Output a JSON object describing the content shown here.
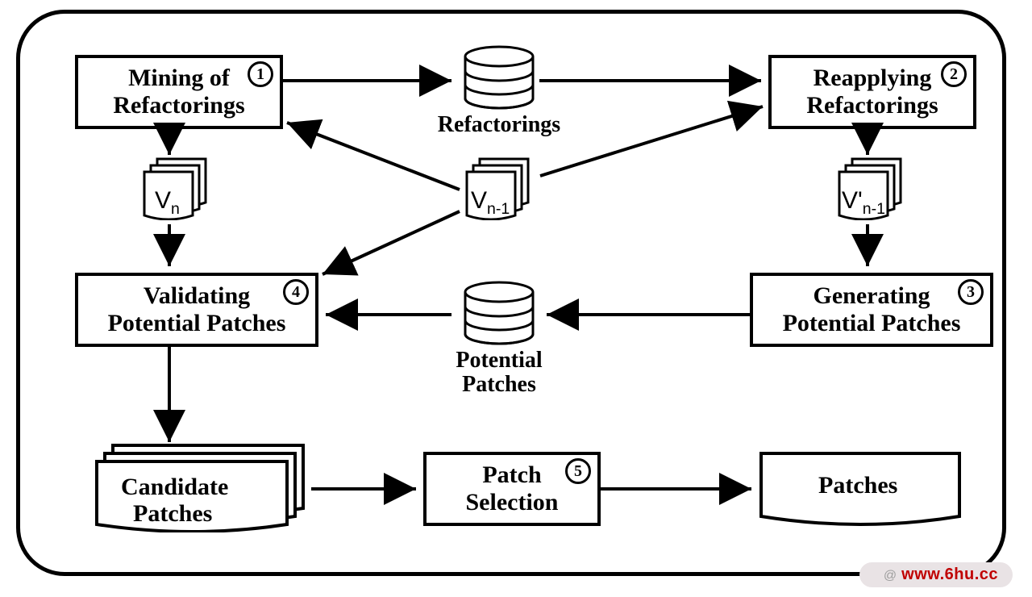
{
  "boxes": {
    "mining": {
      "num": "1",
      "line1": "Mining of",
      "line2": "Refactorings"
    },
    "reapplying": {
      "num": "2",
      "line1": "Reapplying",
      "line2": "Refactorings"
    },
    "generating": {
      "num": "3",
      "line1": "Generating",
      "line2": "Potential Patches"
    },
    "validating": {
      "num": "4",
      "line1": "Validating",
      "line2": "Potential Patches"
    },
    "patchsel": {
      "num": "5",
      "line1": "Patch",
      "line2": "Selection"
    }
  },
  "db": {
    "refactorings": "Refactorings",
    "potential1": "Potential",
    "potential2": "Patches"
  },
  "docs": {
    "vn_base": "V",
    "vn_sub": "n",
    "vnm1_base": "V",
    "vnm1_sub": "n-1",
    "vnp_base": "V'",
    "vnp_sub": "n-1",
    "cand1": "Candidate",
    "cand2": "Patches",
    "patches": "Patches"
  },
  "watermark": {
    "at": "@",
    "url": "www.6hu.cc"
  }
}
